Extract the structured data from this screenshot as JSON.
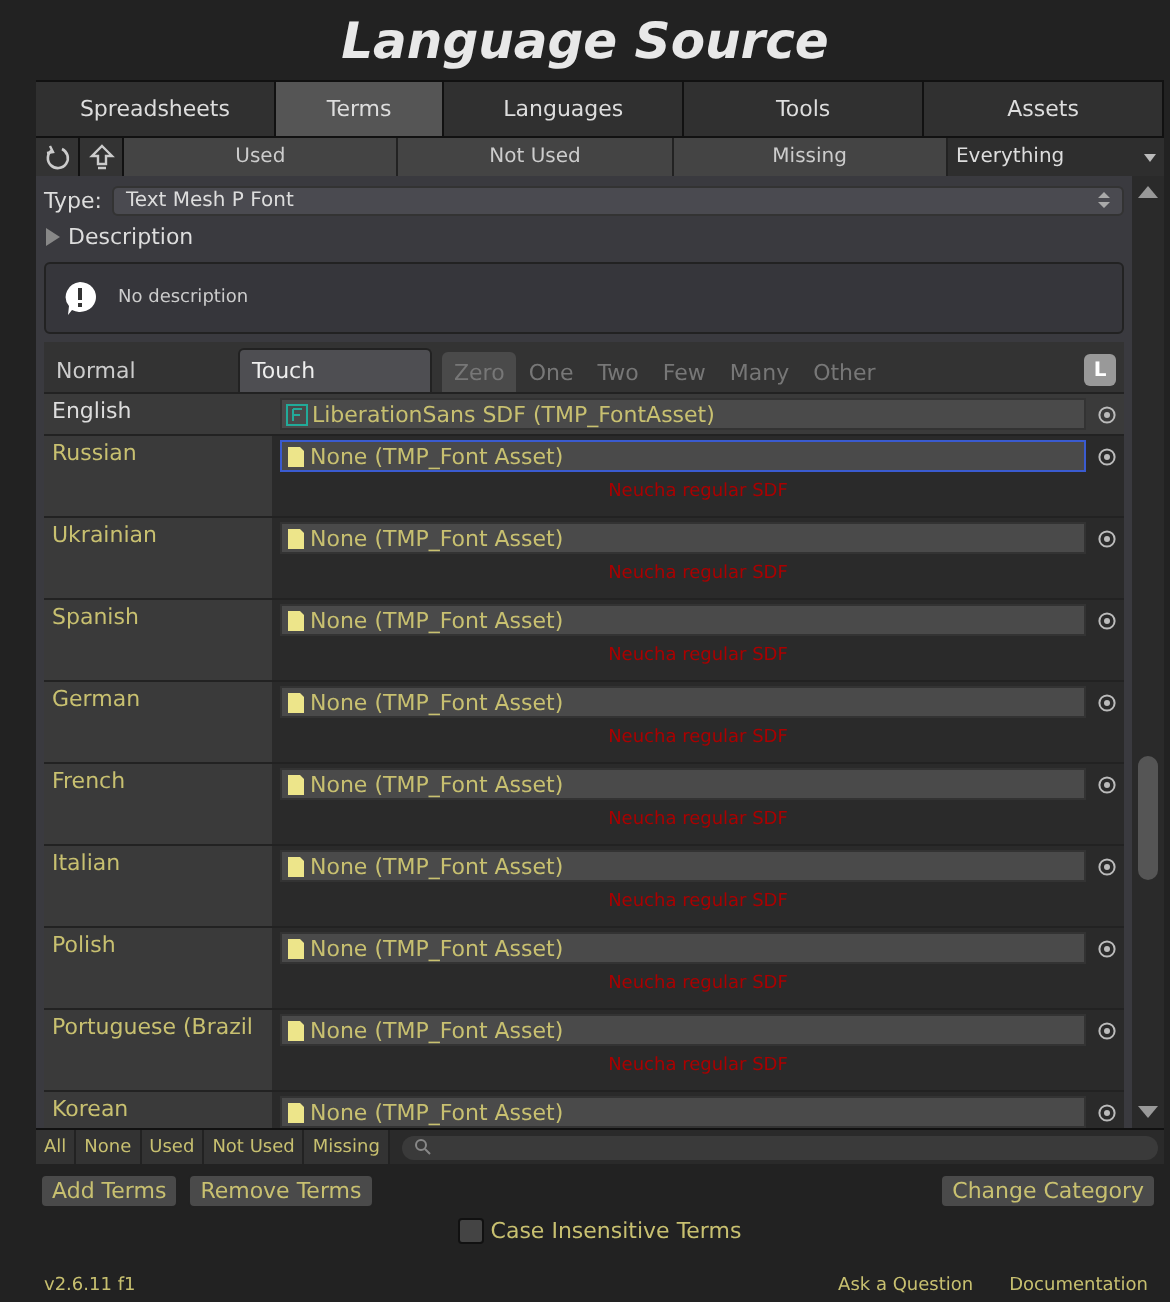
{
  "title": "Language Source",
  "tabs": [
    {
      "label": "Spreadsheets",
      "selected": false
    },
    {
      "label": "Terms",
      "selected": true
    },
    {
      "label": "Languages",
      "selected": false
    },
    {
      "label": "Tools",
      "selected": false
    },
    {
      "label": "Assets",
      "selected": false
    }
  ],
  "filters": [
    {
      "label": "Used"
    },
    {
      "label": "Not Used"
    },
    {
      "label": "Missing"
    }
  ],
  "filter_dropdown": {
    "value": "Everything"
  },
  "type": {
    "label": "Type:",
    "value": "Text Mesh P Font"
  },
  "description": {
    "label": "Description",
    "expanded": false,
    "text": "No description"
  },
  "modes": [
    {
      "label": "Normal",
      "selected": false
    },
    {
      "label": "Touch",
      "selected": true
    }
  ],
  "plurals": [
    {
      "label": "Zero",
      "selected": true
    },
    {
      "label": "One",
      "selected": false
    },
    {
      "label": "Two",
      "selected": false
    },
    {
      "label": "Few",
      "selected": false
    },
    {
      "label": "Many",
      "selected": false
    },
    {
      "label": "Other",
      "selected": false
    }
  ],
  "lock_button": "L",
  "languages": [
    {
      "name": "English",
      "value": "LiberationSans SDF (TMP_FontAsset)",
      "kind": "asset",
      "focused": false
    },
    {
      "name": "Russian",
      "value": "None (TMP_Font Asset)",
      "kind": "none",
      "focused": true,
      "hint": "Neucha regular SDF"
    },
    {
      "name": "Ukrainian",
      "value": "None (TMP_Font Asset)",
      "kind": "none",
      "focused": false,
      "hint": "Neucha regular SDF"
    },
    {
      "name": "Spanish",
      "value": "None (TMP_Font Asset)",
      "kind": "none",
      "focused": false,
      "hint": "Neucha regular SDF"
    },
    {
      "name": "German",
      "value": "None (TMP_Font Asset)",
      "kind": "none",
      "focused": false,
      "hint": "Neucha regular SDF"
    },
    {
      "name": "French",
      "value": "None (TMP_Font Asset)",
      "kind": "none",
      "focused": false,
      "hint": "Neucha regular SDF"
    },
    {
      "name": "Italian",
      "value": "None (TMP_Font Asset)",
      "kind": "none",
      "focused": false,
      "hint": "Neucha regular SDF"
    },
    {
      "name": "Polish",
      "value": "None (TMP_Font Asset)",
      "kind": "none",
      "focused": false,
      "hint": "Neucha regular SDF"
    },
    {
      "name": "Portuguese (Brazil",
      "value": "None (TMP_Font Asset)",
      "kind": "none",
      "focused": false,
      "hint": "Neucha regular SDF"
    },
    {
      "name": "Korean",
      "value": "None (TMP_Font Asset)",
      "kind": "none",
      "focused": false
    }
  ],
  "bottom_filters": [
    {
      "label": "All"
    },
    {
      "label": "None"
    },
    {
      "label": "Used"
    },
    {
      "label": "Not Used"
    },
    {
      "label": "Missing"
    }
  ],
  "buttons": {
    "left": [
      "Add Terms",
      "Remove Terms"
    ],
    "right": "Change Category"
  },
  "case_insensitive": {
    "label": "Case Insensitive Terms",
    "checked": false
  },
  "footer": {
    "version": "v2.6.11 f1",
    "links": [
      "Ask a Question",
      "Documentation"
    ]
  }
}
